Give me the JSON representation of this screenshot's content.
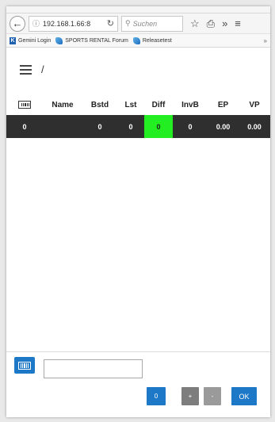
{
  "browser": {
    "url": "192.168.1.66:8",
    "search_placeholder": "Suchen",
    "back_icon": "←",
    "info_icon": "ⓘ",
    "reload_icon": "↻",
    "search_icon": "⚲",
    "star_icon": "☆",
    "bookmarks_menu_icon": "⎙",
    "overflow_icon": "»",
    "menu_icon": "≡",
    "bookmarks": [
      {
        "label": "Gemini Login"
      },
      {
        "label": "SPORTS RENTAL Forum"
      },
      {
        "label": "Releasetest"
      }
    ],
    "bookmarks_more": "»"
  },
  "header": {
    "breadcrumb": "/"
  },
  "table": {
    "columns": [
      "",
      "Name",
      "Bstd",
      "Lst",
      "Diff",
      "InvB",
      "EP",
      "VP"
    ],
    "rows": [
      {
        "id": "0",
        "name": "",
        "bstd": "0",
        "lst": "0",
        "diff": "0",
        "invb": "0",
        "ep": "0.00",
        "vp": "0.00"
      }
    ],
    "diff_highlight_color": "#22ee22"
  },
  "footer": {
    "scan_input_value": "",
    "count_label": "0",
    "plus_label": "+",
    "minus_label": "-",
    "ok_label": "OK"
  },
  "colors": {
    "primary": "#1e78c8",
    "row_bg": "#2f2f2f"
  }
}
